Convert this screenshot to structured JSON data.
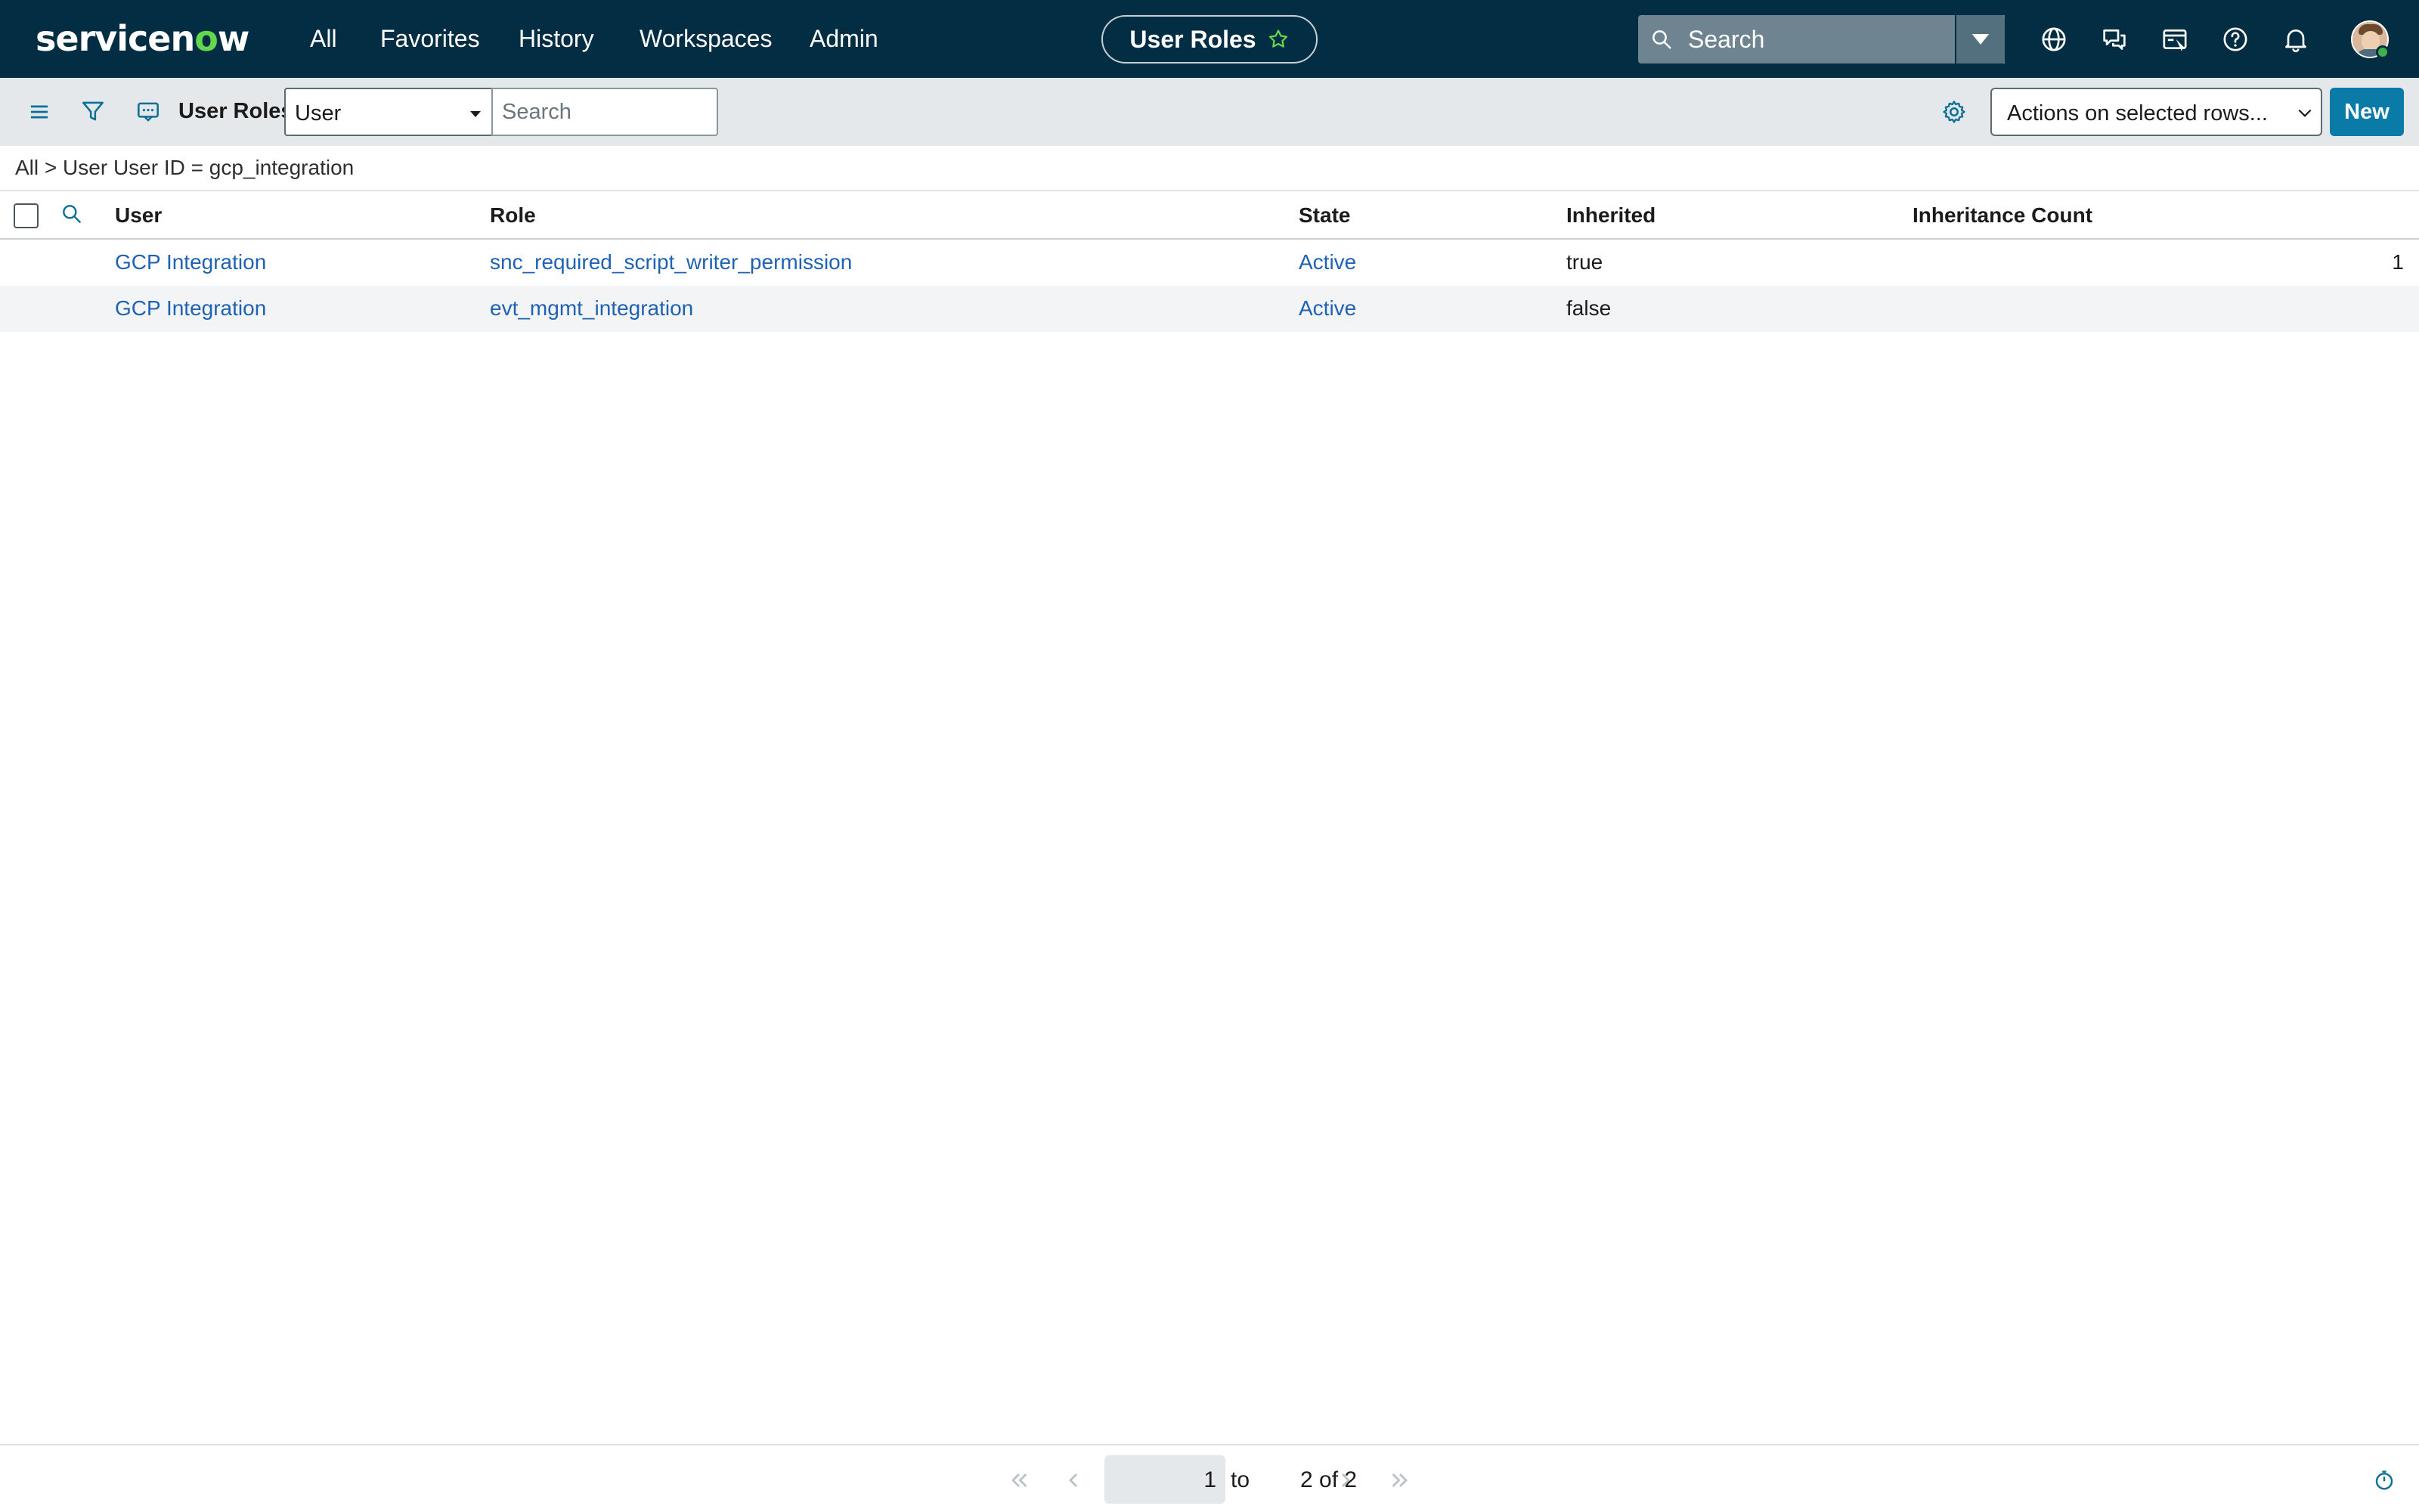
{
  "header": {
    "logo_prefix": "servicen",
    "logo_o": "o",
    "logo_suffix": "w",
    "nav": {
      "all": "All",
      "favorites": "Favorites",
      "history": "History",
      "workspaces": "Workspaces",
      "admin": "Admin"
    },
    "page_title": "User Roles",
    "search_placeholder": "Search",
    "icons": [
      "globe-icon",
      "chat-icon",
      "scratchpad-icon",
      "help-icon",
      "bell-icon"
    ],
    "brand_color": "#032d42",
    "logo_accent": "#62d84e"
  },
  "toolbar": {
    "list_title": "User Roles",
    "field_select_value": "User",
    "search_placeholder": "Search",
    "actions_label": "Actions on selected rows...",
    "new_label": "New",
    "accent": "#0a7aa6"
  },
  "breadcrumb": {
    "root": "All",
    "separator": ">",
    "condition": "User User ID = gcp_integration"
  },
  "table": {
    "columns": {
      "user": "User",
      "role": "Role",
      "state": "State",
      "inherited": "Inherited",
      "inheritance_count": "Inheritance Count"
    },
    "rows": [
      {
        "user": "GCP Integration",
        "role": "snc_required_script_writer_permission",
        "state": "Active",
        "inherited": "true",
        "inheritance_count": "1"
      },
      {
        "user": "GCP Integration",
        "role": "evt_mgmt_integration",
        "state": "Active",
        "inherited": "false",
        "inheritance_count": ""
      }
    ],
    "link_color": "#1f62b3"
  },
  "pagination": {
    "current": "1",
    "to_label": "to",
    "range_end": "2",
    "of_label": "of",
    "total": "2"
  }
}
